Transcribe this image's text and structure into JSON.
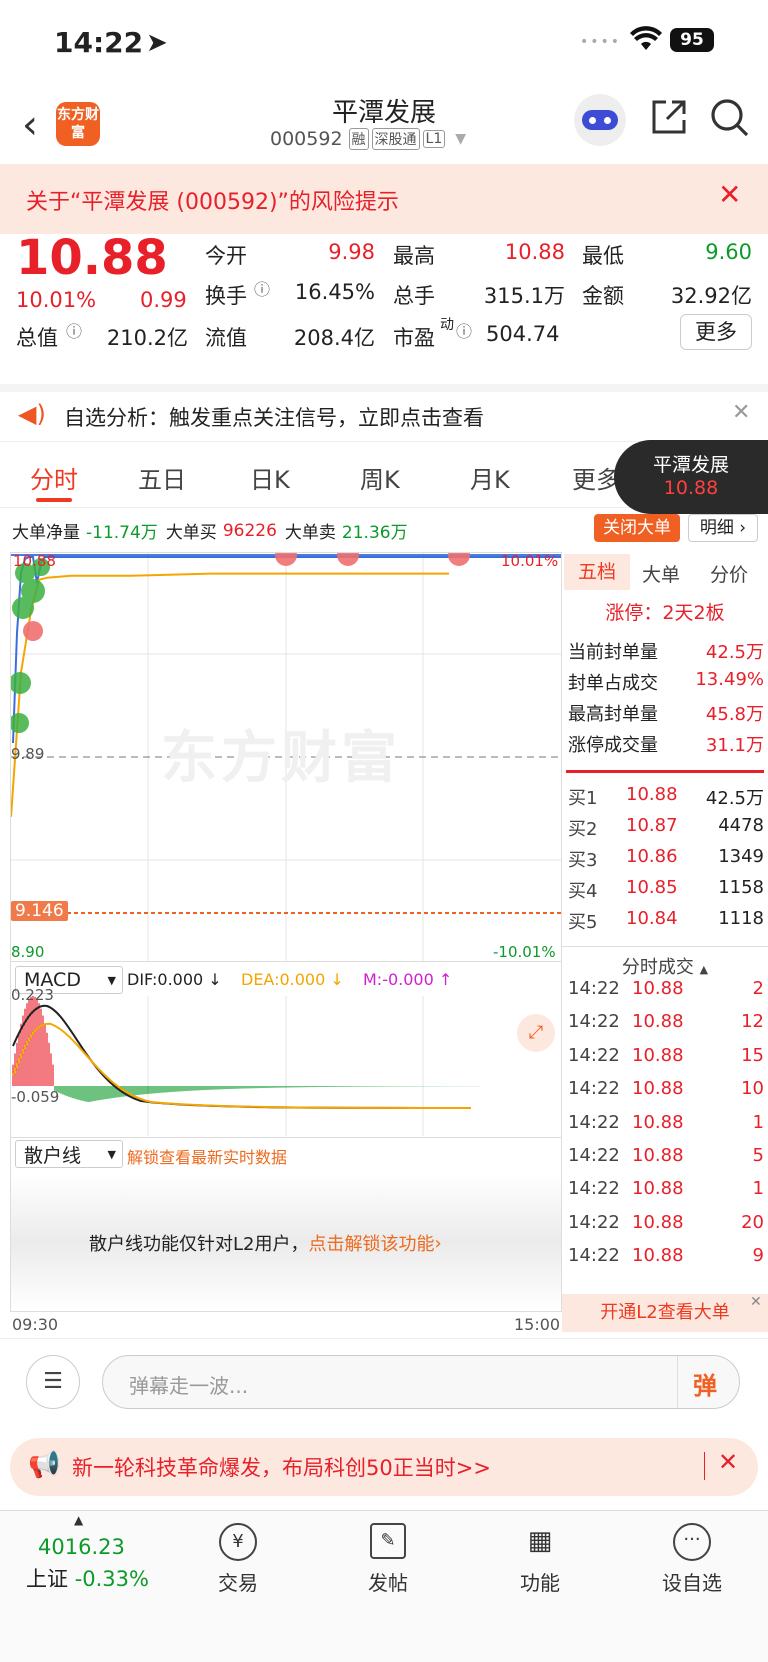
{
  "status": {
    "time": "14:22",
    "battery": "95"
  },
  "nav": {
    "title": "平潭发展",
    "code": "000592",
    "tags": [
      "融",
      "深股通",
      "L1"
    ],
    "logo": "东方财富"
  },
  "risk": {
    "text": "关于“平潭发展 (000592)”的风险提示"
  },
  "quote": {
    "price": "10.88",
    "pct": "10.01%",
    "chg": "0.99",
    "open_l": "今开",
    "open": "9.98",
    "high_l": "最高",
    "high": "10.88",
    "low_l": "最低",
    "low": "9.60",
    "turn_l": "换手",
    "turn": "16.45%",
    "vol_l": "总手",
    "vol": "315.1万",
    "amt_l": "金额",
    "amt": "32.92亿",
    "mcap_l": "总值",
    "mcap": "210.2亿",
    "flt_l": "流值",
    "flt": "208.4亿",
    "pe_l": "市盈",
    "pe_sup": "动",
    "pe": "504.74",
    "more": "更多"
  },
  "ai": {
    "text": "自选分析：触发重点关注信号，立即点击查看"
  },
  "tabs": [
    "分时",
    "五日",
    "日K",
    "周K",
    "月K",
    "更多"
  ],
  "float_tag": {
    "name": "平潭发展",
    "price": "10.88"
  },
  "flow": {
    "net_l": "大单净量",
    "net": "-11.74万",
    "buy_l": "大单买",
    "buy": "96226",
    "sell_l": "大单卖",
    "sell": "21.36万",
    "close_btn": "关闭大单",
    "detail_btn": "明细"
  },
  "chart": {
    "top_l": "10.88",
    "top_r": "10.01%",
    "mid": "9.89",
    "cost": "9.146",
    "bot_l": "8.90",
    "bot_r": "-10.01%",
    "watermark": "东方财富",
    "t_start": "09:30",
    "t_end": "15:00"
  },
  "chart_data": {
    "type": "line",
    "x_range": [
      "09:30",
      "15:00"
    ],
    "ylim": [
      8.9,
      10.88
    ],
    "prev_close": 9.89,
    "series": [
      {
        "values": [
          9.6,
          10.3,
          10.6,
          10.75,
          10.76,
          10.77,
          10.77,
          10.78,
          10.78,
          10.78,
          10.78
        ]
      }
    ]
  },
  "macd": {
    "sel": "MACD",
    "dif": "DIF:0.000 ↓",
    "dea": "DEA:0.000 ↓",
    "m": "M:-0.000 ↑",
    "top": "0.223",
    "bot": "-0.059"
  },
  "retail": {
    "sel": "散户线",
    "unlock": "解锁查看最新实时数据",
    "msg": "散户线功能仅针对L2用户，",
    "link": "点击解锁该功能"
  },
  "side": {
    "tabs": [
      "五档",
      "大单",
      "分价"
    ],
    "limit": "涨停：2天2板",
    "stats": [
      {
        "l": "当前封单量",
        "v": "42.5万"
      },
      {
        "l": "封单占成交",
        "v": "13.49%"
      },
      {
        "l": "最高封单量",
        "v": "45.8万"
      },
      {
        "l": "涨停成交量",
        "v": "31.1万"
      }
    ],
    "bids": [
      {
        "l": "买1",
        "p": "10.88",
        "v": "42.5万"
      },
      {
        "l": "买2",
        "p": "10.87",
        "v": "4478"
      },
      {
        "l": "买3",
        "p": "10.86",
        "v": "1349"
      },
      {
        "l": "买4",
        "p": "10.85",
        "v": "1158"
      },
      {
        "l": "买5",
        "p": "10.84",
        "v": "1118"
      }
    ],
    "ticks_title": "分时成交",
    "ticks": [
      {
        "t": "14:22",
        "p": "10.88",
        "v": "2"
      },
      {
        "t": "14:22",
        "p": "10.88",
        "v": "12"
      },
      {
        "t": "14:22",
        "p": "10.88",
        "v": "15"
      },
      {
        "t": "14:22",
        "p": "10.88",
        "v": "10"
      },
      {
        "t": "14:22",
        "p": "10.88",
        "v": "1"
      },
      {
        "t": "14:22",
        "p": "10.88",
        "v": "5"
      },
      {
        "t": "14:22",
        "p": "10.88",
        "v": "1"
      },
      {
        "t": "14:22",
        "p": "10.88",
        "v": "20"
      },
      {
        "t": "14:22",
        "p": "10.88",
        "v": "9"
      }
    ],
    "l2": "开通L2查看大单"
  },
  "comment": {
    "placeholder": "弹幕走一波...",
    "btn": "弹"
  },
  "ad": {
    "text": "新一轮科技革命爆发，布局科创50正当时>>"
  },
  "bottom": {
    "index": "4016.23",
    "index_name": "上证",
    "index_pct": "-0.33%",
    "items": [
      "交易",
      "发帖",
      "功能",
      "设自选"
    ]
  }
}
